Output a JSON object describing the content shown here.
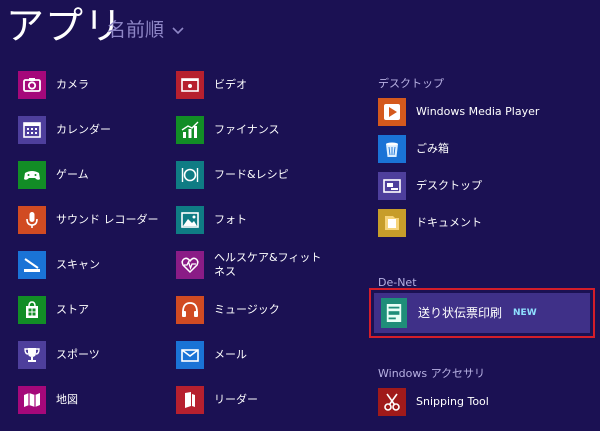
{
  "header": {
    "title": "アプリ",
    "sort_label": "名前順"
  },
  "col1": [
    {
      "label": "カメラ",
      "icon": "camera-icon",
      "color": "#a5087a"
    },
    {
      "label": "カレンダー",
      "icon": "calendar-icon",
      "color": "#4e3f9c"
    },
    {
      "label": "ゲーム",
      "icon": "game-controller-icon",
      "color": "#128d26"
    },
    {
      "label": "サウンド レコーダー",
      "icon": "microphone-icon",
      "color": "#d14b22"
    },
    {
      "label": "スキャン",
      "icon": "scanner-icon",
      "color": "#1a73d6"
    },
    {
      "label": "ストア",
      "icon": "store-icon",
      "color": "#128d26"
    },
    {
      "label": "スポーツ",
      "icon": "trophy-icon",
      "color": "#4e3f9c"
    },
    {
      "label": "地図",
      "icon": "map-icon",
      "color": "#a5087a"
    }
  ],
  "col2": [
    {
      "label": "ビデオ",
      "icon": "video-icon",
      "color": "#b7202e"
    },
    {
      "label": "ファイナンス",
      "icon": "finance-chart-icon",
      "color": "#128d26"
    },
    {
      "label": "フード&レシピ",
      "icon": "food-icon",
      "color": "#0f7c84"
    },
    {
      "label": "フォト",
      "icon": "photo-icon",
      "color": "#0f7c84"
    },
    {
      "label": "ヘルスケア&フィットネス",
      "icon": "health-heart-icon",
      "color": "#8a1c86"
    },
    {
      "label": "ミュージック",
      "icon": "headphones-icon",
      "color": "#d14b22"
    },
    {
      "label": "メール",
      "icon": "mail-icon",
      "color": "#1a73d6"
    },
    {
      "label": "リーダー",
      "icon": "reader-icon",
      "color": "#b7202e"
    }
  ],
  "groups": {
    "desktop": {
      "header": "デスクトップ",
      "items": [
        {
          "label": "Windows Media Player",
          "icon": "media-player-icon",
          "color": "#d4591d"
        },
        {
          "label": "ごみ箱",
          "icon": "recycle-bin-icon",
          "color": "#1a73d6"
        },
        {
          "label": "デスクトップ",
          "icon": "desktop-icon",
          "color": "#4e3f9c"
        },
        {
          "label": "ドキュメント",
          "icon": "documents-folder-icon",
          "color": "#c79d2a"
        }
      ]
    },
    "denet": {
      "header": "De-Net",
      "tile": {
        "label": "送り状伝票印刷",
        "badge": "NEW",
        "icon": "invoice-icon",
        "color": "#1f8e79"
      }
    },
    "accessories": {
      "header": "Windows アクセサリ",
      "items": [
        {
          "label": "Snipping Tool",
          "icon": "scissors-icon",
          "color": "#a01a1a"
        }
      ]
    }
  }
}
